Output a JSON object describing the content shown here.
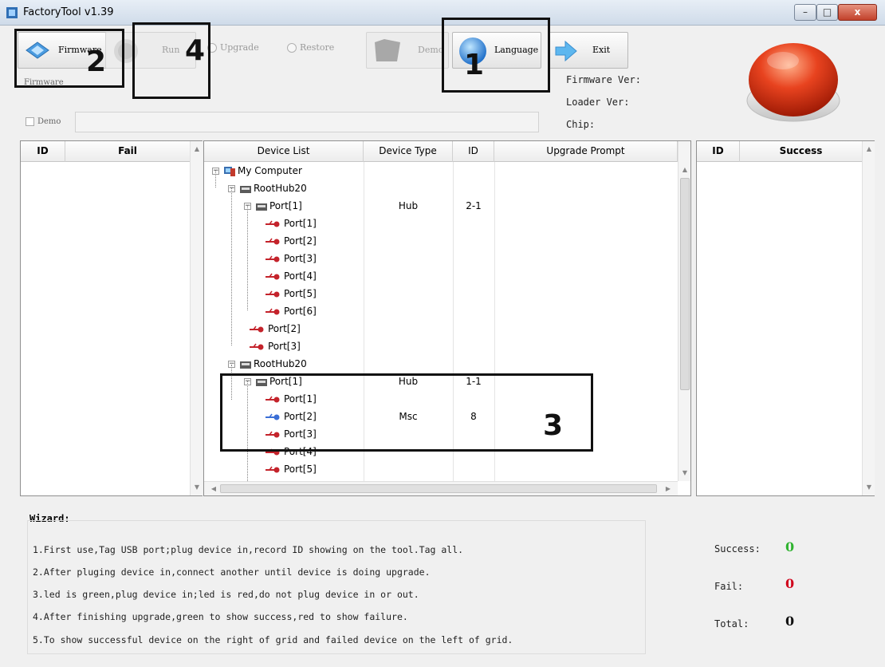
{
  "window": {
    "title": "FactoryTool v1.39",
    "minimize_glyph": "–",
    "maximize_glyph": "□",
    "close_glyph": "x"
  },
  "toolbar": {
    "firmware_label": "Firmware",
    "run_label": "Run",
    "upgrade_label": "Upgrade",
    "restore_label": "Restore",
    "demo_label": "Demo",
    "language_label": "Language",
    "exit_label": "Exit"
  },
  "firmware_section": {
    "label": "Firmware",
    "demo_checkbox_label": "Demo",
    "demo_checked": false
  },
  "device_info": {
    "firmware_ver": "Firmware Ver:",
    "loader_ver": "Loader Ver:",
    "chip": "Chip:"
  },
  "status_led": {
    "color": "#e8431f"
  },
  "fail_grid": {
    "columns": [
      "ID",
      "Fail"
    ],
    "rows": []
  },
  "success_grid": {
    "columns": [
      "ID",
      "Success"
    ],
    "rows": []
  },
  "device_grid": {
    "columns": [
      "Device List",
      "Device Type",
      "ID",
      "Upgrade Prompt"
    ],
    "rows": [
      {
        "label": "My Computer",
        "type": "",
        "id": ""
      },
      {
        "label": "RootHub20",
        "type": "",
        "id": ""
      },
      {
        "label": "Port[1]",
        "type": "Hub",
        "id": "2-1"
      },
      {
        "label": "Port[1]",
        "type": "",
        "id": ""
      },
      {
        "label": "Port[2]",
        "type": "",
        "id": ""
      },
      {
        "label": "Port[3]",
        "type": "",
        "id": ""
      },
      {
        "label": "Port[4]",
        "type": "",
        "id": ""
      },
      {
        "label": "Port[5]",
        "type": "",
        "id": ""
      },
      {
        "label": "Port[6]",
        "type": "",
        "id": ""
      },
      {
        "label": "Port[2]",
        "type": "",
        "id": ""
      },
      {
        "label": "Port[3]",
        "type": "",
        "id": ""
      },
      {
        "label": "RootHub20",
        "type": "",
        "id": ""
      },
      {
        "label": "Port[1]",
        "type": "Hub",
        "id": "1-1"
      },
      {
        "label": "Port[1]",
        "type": "",
        "id": ""
      },
      {
        "label": "Port[2]",
        "type": "Msc",
        "id": "8"
      },
      {
        "label": "Port[3]",
        "type": "",
        "id": ""
      },
      {
        "label": "Port[4]",
        "type": "",
        "id": ""
      },
      {
        "label": "Port[5]",
        "type": "",
        "id": ""
      }
    ]
  },
  "wizard": {
    "title": "Wizard:",
    "lines": [
      "1.First use,Tag USB port;plug device in,record ID showing on the tool.Tag all.",
      "2.After pluging device in,connect another until device is doing upgrade.",
      "3.led is green,plug device in;led is red,do not plug device in or out.",
      "4.After finishing upgrade,green to show success,red to show failure.",
      "5.To show successful device on the right of grid and failed device on the left of grid."
    ]
  },
  "stats": {
    "success_label": "Success:",
    "success_value": "0",
    "success_color": "#2fb32f",
    "fail_label": "Fail:",
    "fail_value": "0",
    "fail_color": "#d0021b",
    "total_label": "Total:",
    "total_value": "0",
    "total_color": "#111111"
  },
  "annotations": {
    "a1": "1",
    "a2": "2",
    "a3": "3",
    "a4": "4"
  }
}
